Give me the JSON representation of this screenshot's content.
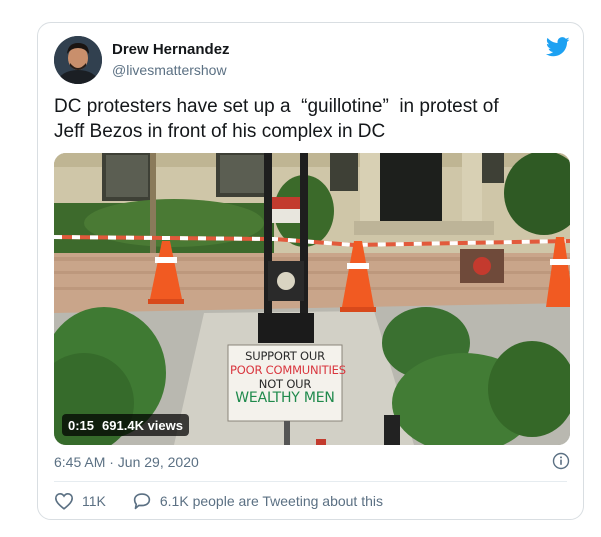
{
  "author": {
    "name": "Drew Hernandez",
    "handle": "@livesmattershow"
  },
  "tweet": {
    "text": "DC protesters have set up a  “guillotine”  in protest of\nJeff Bezos in front of his complex in DC"
  },
  "media": {
    "duration": "0:15",
    "views": "691.4K views",
    "sign": {
      "line1": "SUPPORT OUR",
      "line2": "POOR COMMUNITIES",
      "line3": "NOT OUR",
      "line4": "WEALTHY MEN"
    }
  },
  "meta": {
    "timestamp": "6:45 AM · Jun 29, 2020"
  },
  "actions": {
    "likes": "11K",
    "conversation": "6.1K people are Tweeting about this"
  },
  "icons": {
    "brand": "twitter-bird-icon",
    "info": "info-icon",
    "like": "heart-icon",
    "reply": "speech-bubble-icon"
  },
  "colors": {
    "brand": "#1da1f2",
    "text": "#14171a",
    "secondary": "#5b7083"
  }
}
